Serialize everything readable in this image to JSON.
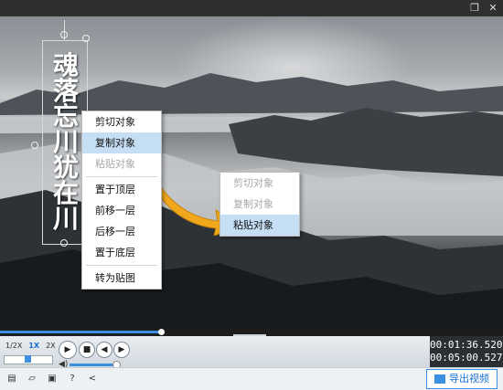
{
  "window": {
    "restore_glyph": "❐",
    "close_glyph": "✕"
  },
  "canvas": {
    "title_chars": [
      "魂",
      "落",
      "忘",
      "川",
      "犹",
      "在",
      "川"
    ]
  },
  "context_menu_main": {
    "items": [
      {
        "label": "剪切对象",
        "state": "enabled"
      },
      {
        "label": "复制对象",
        "state": "hover"
      },
      {
        "label": "粘贴对象",
        "state": "disabled"
      },
      {
        "label": "置于顶层",
        "state": "enabled"
      },
      {
        "label": "前移一层",
        "state": "enabled"
      },
      {
        "label": "后移一层",
        "state": "enabled"
      },
      {
        "label": "置于底层",
        "state": "enabled"
      },
      {
        "label": "转为贴图",
        "state": "enabled"
      }
    ]
  },
  "context_menu_secondary": {
    "items": [
      {
        "label": "剪切对象",
        "state": "disabled"
      },
      {
        "label": "复制对象",
        "state": "disabled"
      },
      {
        "label": "粘贴对象",
        "state": "hover"
      }
    ]
  },
  "playback": {
    "progress_fraction": 0.32,
    "speed_options": [
      "1/2X",
      "1X",
      "2X"
    ],
    "speed_selected": "1X",
    "volume_fraction": 1.0,
    "current_time": "00:01:36.520",
    "total_time": "00:05:00.527"
  },
  "footer": {
    "tools": [
      "new-file-icon",
      "open-folder-icon",
      "save-icon",
      "help-icon",
      "share-icon"
    ],
    "export_label": "导出视频"
  },
  "colors": {
    "accent": "#3a8fde",
    "menu_hover": "#c6def4",
    "arrow": "#f2a81d"
  }
}
